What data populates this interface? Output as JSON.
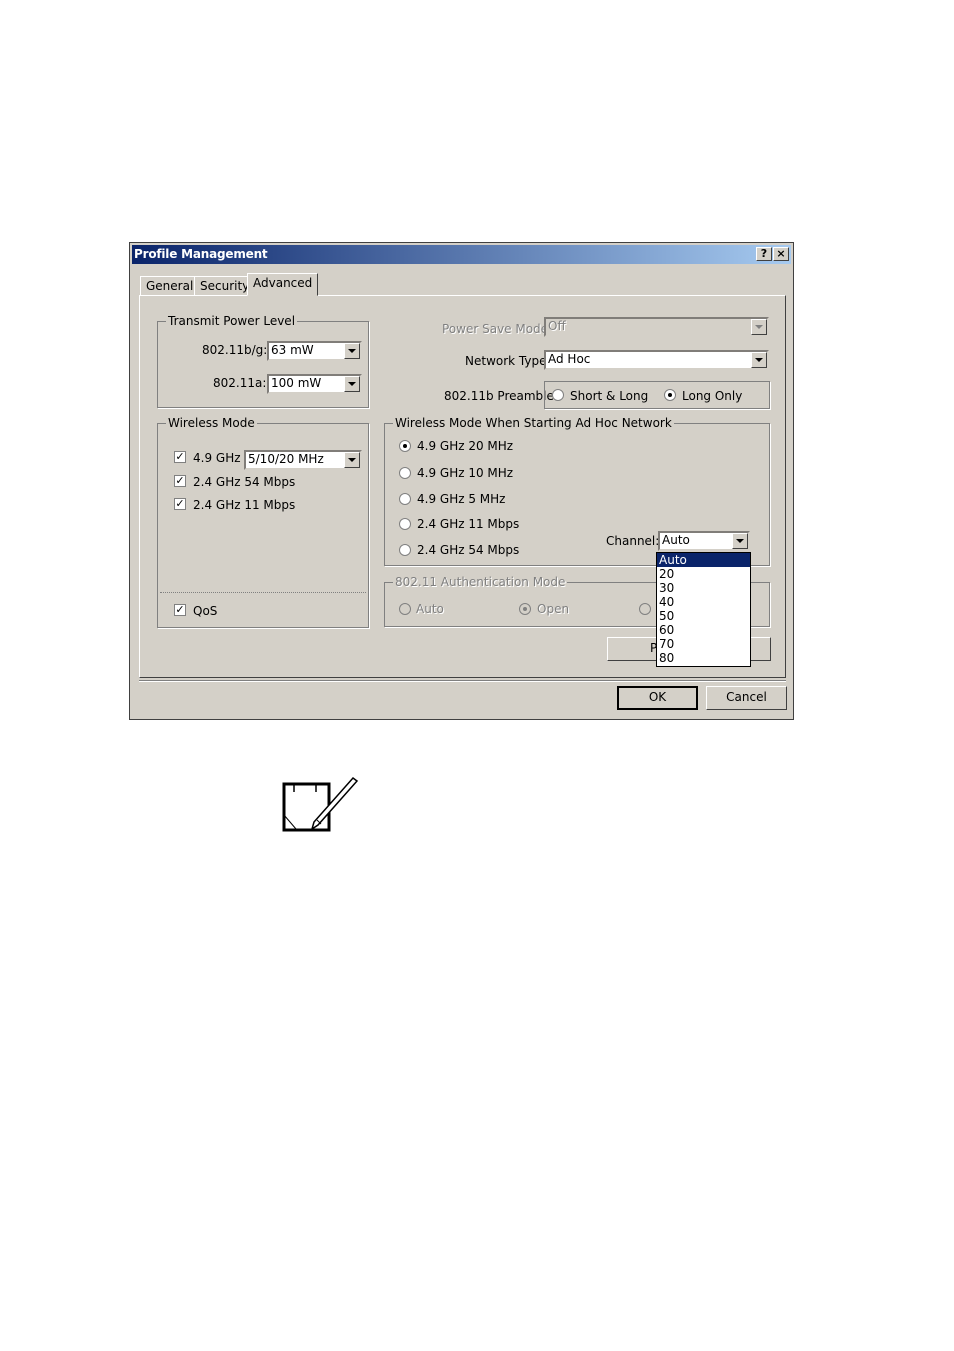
{
  "window": {
    "title": "Profile Management",
    "help_glyph": "?",
    "close_glyph": "×"
  },
  "tabs": [
    {
      "label": "General",
      "active": false
    },
    {
      "label": "Security",
      "active": false
    },
    {
      "label": "Advanced",
      "active": true
    }
  ],
  "transmit_power": {
    "group_label": "Transmit Power Level",
    "bg_label": "802.11b/g:",
    "bg_value": "63 mW",
    "a_label": "802.11a:",
    "a_value": "100 mW"
  },
  "power_save": {
    "label": "Power Save Mode:",
    "value": "Off",
    "enabled": false
  },
  "network_type": {
    "label": "Network Type:",
    "value": "Ad Hoc"
  },
  "preamble": {
    "label": "802.11b Preamble:",
    "options": [
      {
        "label": "Short & Long",
        "selected": false
      },
      {
        "label": "Long Only",
        "selected": true
      }
    ]
  },
  "wireless_mode": {
    "group_label": "Wireless Mode",
    "items": [
      {
        "label": "4.9 GHz",
        "checked": true
      },
      {
        "label": "2.4 GHz 54 Mbps",
        "checked": true
      },
      {
        "label": "2.4 GHz 11 Mbps",
        "checked": true
      }
    ],
    "bandwidth_value": "5/10/20 MHz",
    "qos_label": "QoS",
    "qos_checked": true
  },
  "adhoc_mode": {
    "group_label": "Wireless Mode When Starting Ad Hoc Network",
    "options": [
      {
        "label": "4.9 GHz 20 MHz",
        "selected": true
      },
      {
        "label": "4.9 GHz 10 MHz",
        "selected": false
      },
      {
        "label": "4.9 GHz 5 MHz",
        "selected": false
      },
      {
        "label": "2.4 GHz 11 Mbps",
        "selected": false
      },
      {
        "label": "2.4 GHz 54 Mbps",
        "selected": false
      }
    ],
    "channel_label": "Channel:",
    "channel_value": "Auto",
    "channel_options": [
      "Auto",
      "20",
      "30",
      "40",
      "50",
      "60",
      "70",
      "80"
    ],
    "channel_selected_index": 0
  },
  "auth_mode": {
    "group_label": "802.11 Authentication Mode",
    "options": [
      {
        "label": "Auto",
        "selected": false
      },
      {
        "label": "Open",
        "selected": true
      }
    ],
    "enabled": false
  },
  "partial_button_label": "P",
  "buttons": {
    "ok": "OK",
    "cancel": "Cancel"
  },
  "note_icon": "note-pencil-icon"
}
